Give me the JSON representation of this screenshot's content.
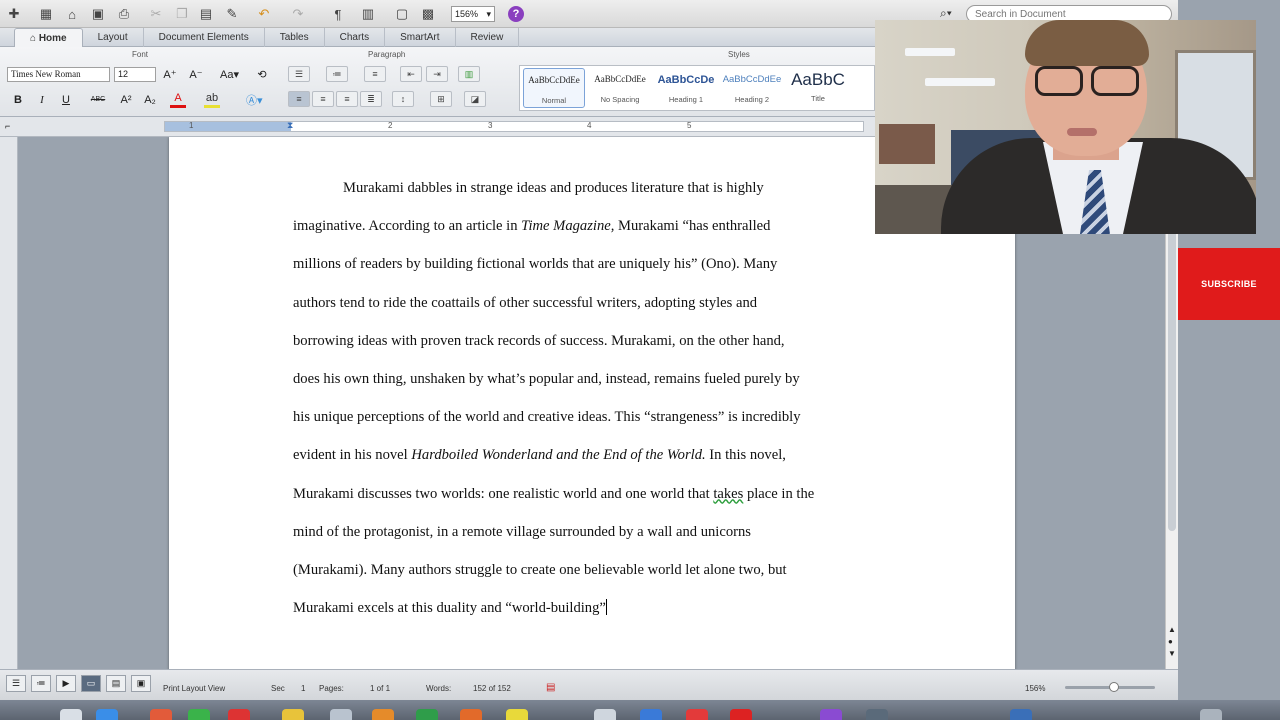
{
  "toolbar": {
    "zoom_value": "156%",
    "search_placeholder": "Search in Document"
  },
  "ribbon_tabs": [
    "Home",
    "Layout",
    "Document Elements",
    "Tables",
    "Charts",
    "SmartArt",
    "Review"
  ],
  "ribbon": {
    "group_font": "Font",
    "group_paragraph": "Paragraph",
    "group_styles": "Styles",
    "font_name": "Times New Roman",
    "font_size": "12",
    "bold": "B",
    "italic": "I",
    "underline": "U",
    "strike": "ABC",
    "superscript": "A²",
    "subscript": "A₂",
    "styles": [
      {
        "sample": "AaBbCcDdEe",
        "name": "Normal"
      },
      {
        "sample": "AaBbCcDdEe",
        "name": "No Spacing"
      },
      {
        "sample": "AaBbCcDe",
        "name": "Heading 1"
      },
      {
        "sample": "AaBbCcDdEe",
        "name": "Heading 2"
      },
      {
        "sample": "AaBbC",
        "name": "Title"
      }
    ]
  },
  "ruler": {
    "labels": [
      "1",
      "2",
      "3",
      "4",
      "5"
    ]
  },
  "document": {
    "lines": [
      {
        "text": "Murakami dabbles in strange ideas and produces literature that is highly"
      },
      {
        "a": "imaginative.  According to an article in ",
        "i": "Time Magazine,",
        "b": " Murakami “has enthralled"
      },
      {
        "text": "millions of readers by building fictional worlds that are uniquely his” (Ono).  Many"
      },
      {
        "text": "authors tend to ride the coattails of other successful writers, adopting styles and"
      },
      {
        "text": "borrowing ideas with proven track records of success.  Murakami, on the other hand,"
      },
      {
        "text": "does his own thing, unshaken by what’s popular and, instead, remains fueled purely by"
      },
      {
        "text": "his unique perceptions of the world and creative ideas.  This “strangeness” is incredibly"
      },
      {
        "a": "evident in his novel ",
        "i": "Hardboiled Wonderland and the End of the World.",
        "b": "  In this novel,"
      },
      {
        "a": "Murakami discusses two worlds: one realistic world and one world that ",
        "s": "takes",
        "b": " place in the"
      },
      {
        "text": "mind of the protagonist, in a remote village surrounded by a wall and unicorns"
      },
      {
        "text": "(Murakami).  Many authors struggle to create one believable world let alone two, but"
      },
      {
        "text": "Murakami excels at this duality and “world-building”"
      }
    ]
  },
  "statusbar": {
    "view": "Print Layout View",
    "sec_label": "Sec",
    "sec_value": "1",
    "pages_label": "Pages:",
    "pages_value": "1 of 1",
    "words_label": "Words:",
    "words_value": "152 of 152",
    "zoom": "156%"
  },
  "overlay": {
    "subscribe_label": "SUBSCRIBE"
  },
  "colors": {
    "subscribe_red": "#e01b1b",
    "help_purple": "#8a3fbf",
    "spell_green": "#2e9e3e"
  }
}
